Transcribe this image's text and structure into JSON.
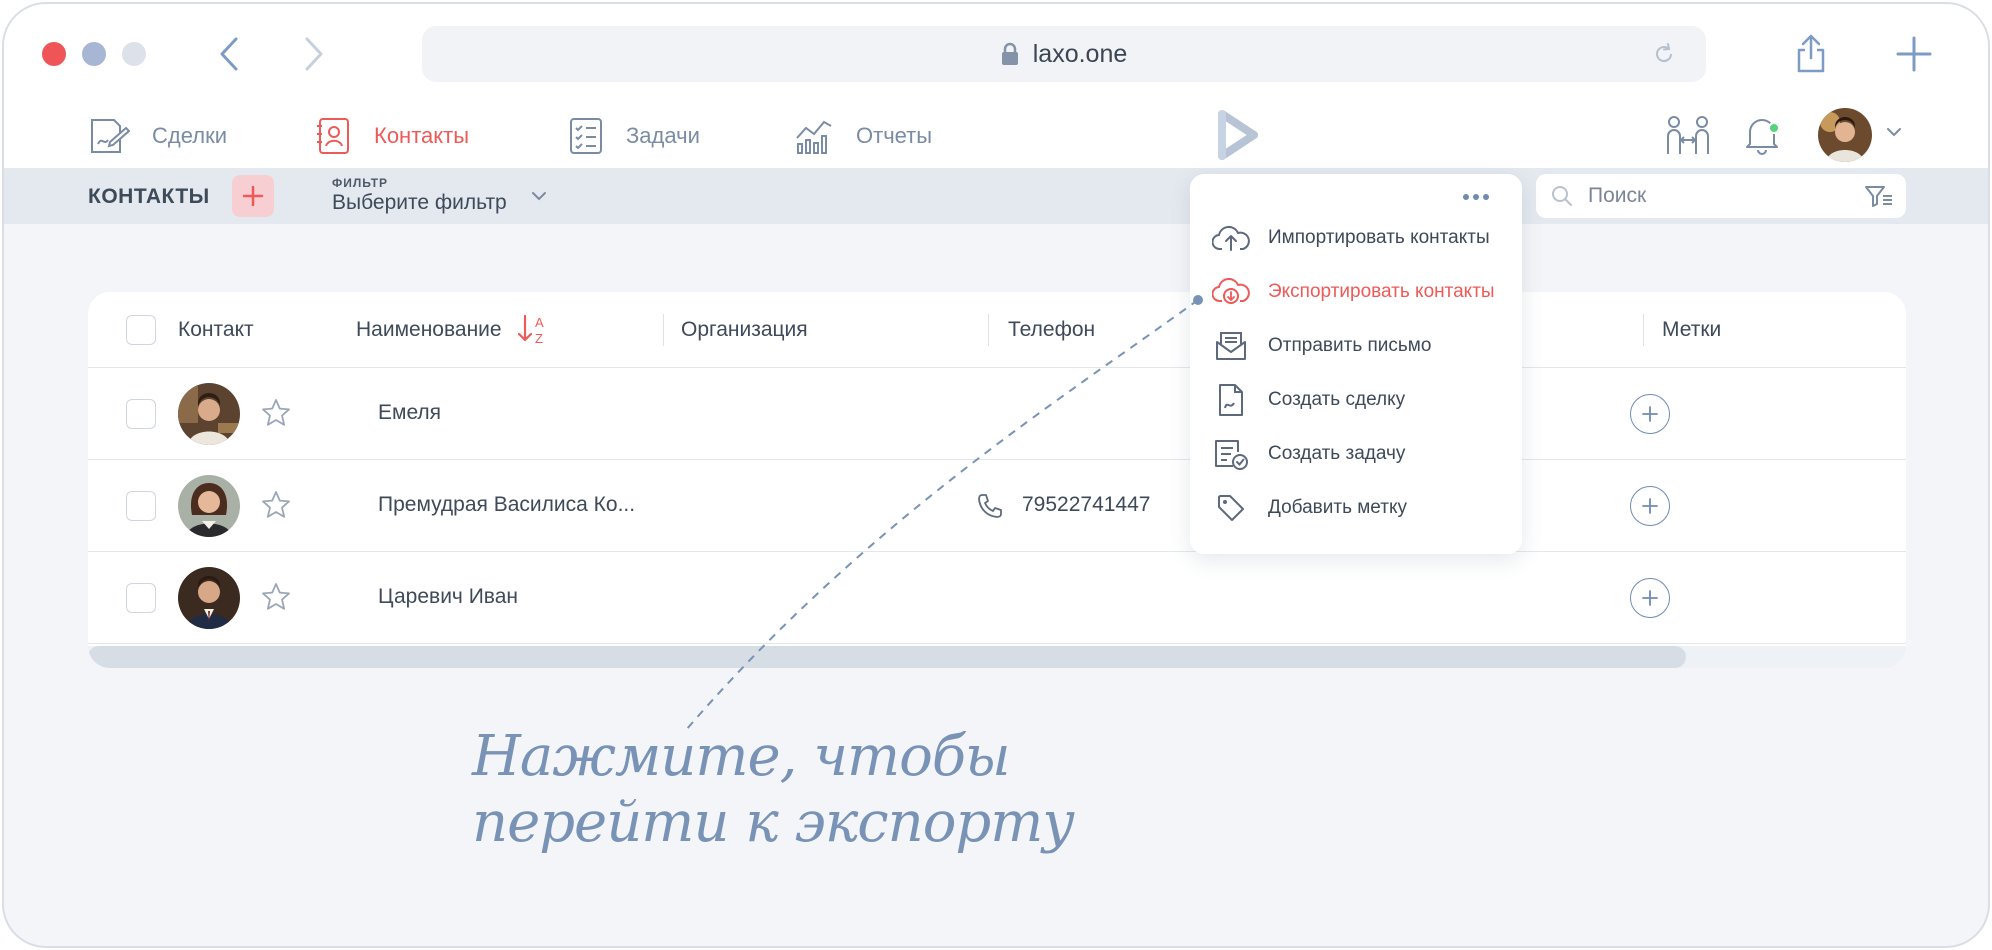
{
  "browser": {
    "url": "laxo.one"
  },
  "nav": {
    "items": [
      {
        "label": "Сделки",
        "icon": "deals-icon"
      },
      {
        "label": "Контакты",
        "icon": "contacts-icon"
      },
      {
        "label": "Задачи",
        "icon": "tasks-icon"
      },
      {
        "label": "Отчеты",
        "icon": "reports-icon"
      }
    ]
  },
  "toolbar": {
    "title": "КОНТАКТЫ",
    "filter_label": "ФИЛЬТР",
    "filter_value": "Выберите фильтр",
    "search_placeholder": "Поиск"
  },
  "table": {
    "headers": [
      "Контакт",
      "Наименование",
      "Организация",
      "Телефон",
      "Метки"
    ],
    "rows": [
      {
        "name": "Емеля",
        "phone": ""
      },
      {
        "name": "Премудрая Василиса Ко...",
        "phone": "79522741447"
      },
      {
        "name": "Царевич Иван",
        "phone": ""
      }
    ]
  },
  "menu": {
    "items": [
      {
        "label": "Импортировать контакты",
        "icon": "cloud-upload-icon"
      },
      {
        "label": "Экспортировать контакты",
        "icon": "cloud-download-icon"
      },
      {
        "label": "Отправить письмо",
        "icon": "mail-icon"
      },
      {
        "label": "Создать сделку",
        "icon": "deal-document-icon"
      },
      {
        "label": "Создать задачу",
        "icon": "task-check-icon"
      },
      {
        "label": "Добавить метку",
        "icon": "tag-icon"
      }
    ]
  },
  "annotation": {
    "line1": "Нажмите, чтобы",
    "line2": "перейти к экспорту"
  },
  "colors": {
    "accent": "#ee5a58",
    "nav_text": "#7a8ba4",
    "background": "#f3f5f8",
    "toolbar": "#e4e9ef",
    "annotation": "#7893b5"
  }
}
